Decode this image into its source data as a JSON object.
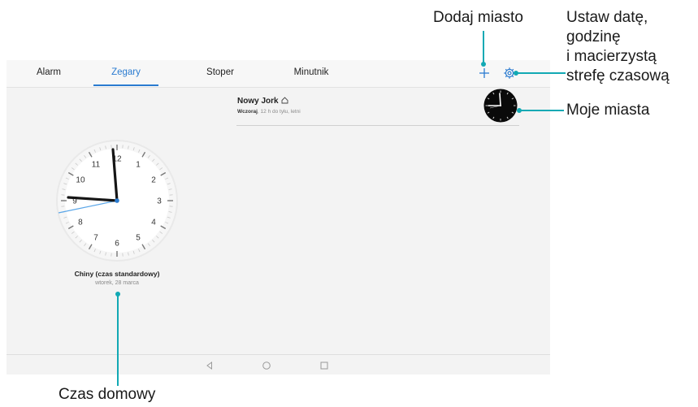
{
  "tabs": [
    {
      "label": "Alarm",
      "active": false
    },
    {
      "label": "Zegary",
      "active": true
    },
    {
      "label": "Stoper",
      "active": false
    },
    {
      "label": "Minutnik",
      "active": false
    }
  ],
  "toolbar": {
    "add_icon": "plus-icon",
    "settings_icon": "gear-icon"
  },
  "home_clock": {
    "city": "Chiny (czas standardowy)",
    "date": "wtorek, 28 marca",
    "numbers": [
      "12",
      "1",
      "2",
      "3",
      "4",
      "5",
      "6",
      "7",
      "8",
      "9",
      "10",
      "11"
    ]
  },
  "cities": [
    {
      "name": "Nowy Jork",
      "day": "Wczoraj",
      "offset": ", 12 h do tyłu, letni"
    }
  ],
  "nav": {
    "back_icon": "triangle-back-icon",
    "home_icon": "circle-home-icon",
    "recent_icon": "square-recent-icon"
  },
  "annotations": {
    "add_city": "Dodaj miasto",
    "settings": [
      "Ustaw datę,",
      "godzinę",
      "i macierzystą",
      "strefę czasową"
    ],
    "my_cities": "Moje miasta",
    "home_time": "Czas domowy"
  },
  "colors": {
    "accent": "#2a7bd0",
    "callout_line": "#12a9b4",
    "second_hand": "#5aa6e8"
  }
}
